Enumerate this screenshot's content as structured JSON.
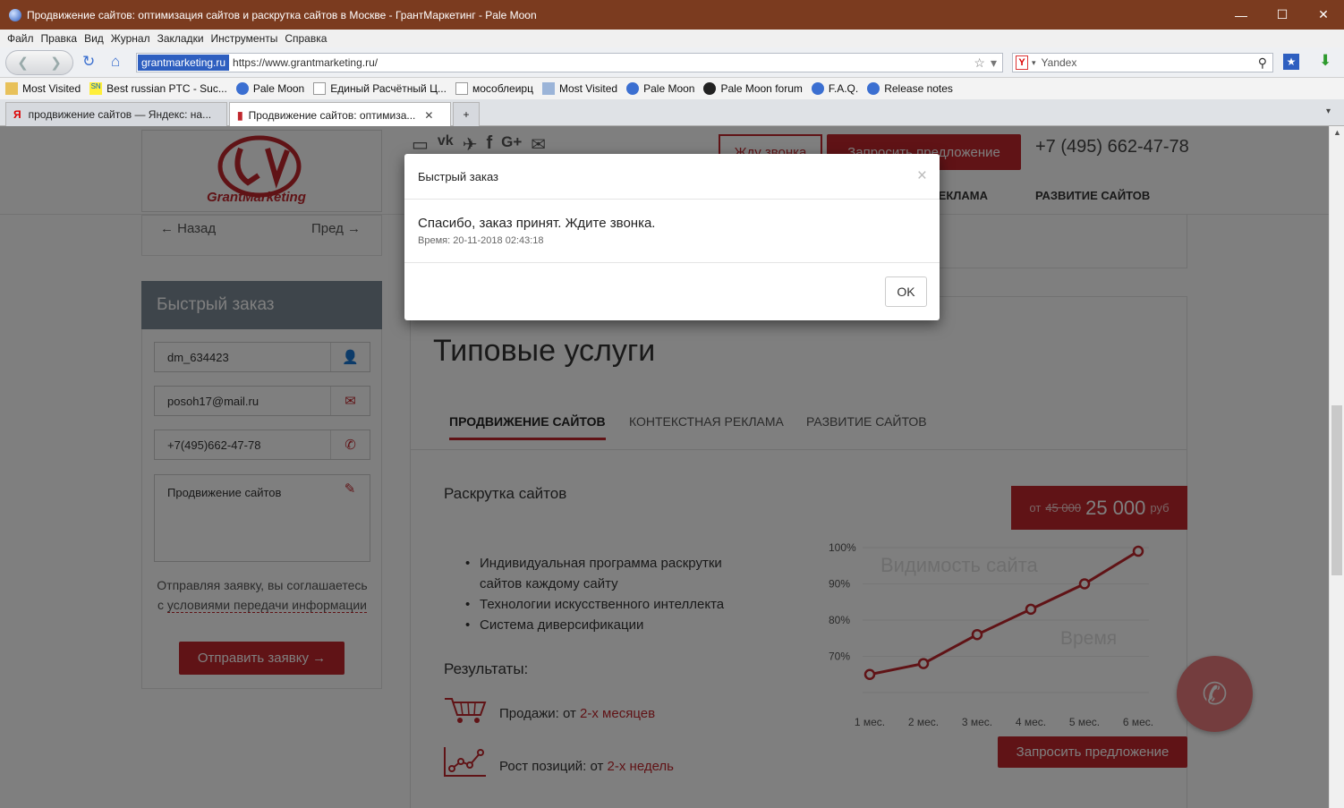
{
  "window": {
    "title": "Продвижение сайтов: оптимизация сайтов и раскрутка сайтов в Москве - ГрантМаркетинг - Pale Moon",
    "minimize": "—",
    "maximize": "☐",
    "close": "✕"
  },
  "menu": [
    "Файл",
    "Правка",
    "Вид",
    "Журнал",
    "Закладки",
    "Инструменты",
    "Справка"
  ],
  "nav": {
    "identity": "grantmarketing.ru",
    "url": "https://www.grantmarketing.ru/",
    "search_engine": "Yandex",
    "search_placeholder": "Yandex"
  },
  "bookmarks": [
    {
      "label": "Most Visited",
      "icon": "folder-icon"
    },
    {
      "label": "Best russian PTC - Suc...",
      "icon": "sn-icon"
    },
    {
      "label": "Pale Moon",
      "icon": "globe-icon"
    },
    {
      "label": "Единый Расчётный Ц...",
      "icon": "page-icon"
    },
    {
      "label": "мособлеирц",
      "icon": "page-icon"
    },
    {
      "label": "Most Visited",
      "icon": "folder-icon"
    },
    {
      "label": "Pale Moon",
      "icon": "globe-icon"
    },
    {
      "label": "Pale Moon forum",
      "icon": "forum-icon"
    },
    {
      "label": "F.A.Q.",
      "icon": "globe-icon"
    },
    {
      "label": "Release notes",
      "icon": "globe-icon"
    }
  ],
  "tabs": [
    {
      "label": "продвижение сайтов — Яндекс: на...",
      "active": false
    },
    {
      "label": "Продвижение сайтов: оптимиза...",
      "active": true
    }
  ],
  "header": {
    "logo_text": "GrantMarketing",
    "callback_label": "Жду звонка",
    "request_label": "Запросить предложение",
    "phone": "+7 (495) 662-47-78",
    "nav_items": [
      "РЕКЛАМА",
      "РАЗВИТИЕ САЙТОВ"
    ]
  },
  "sidebar": {
    "prev_label": "← Назад",
    "next_label": "Пред →",
    "form_title": "Быстрый заказ",
    "name_value": "dm_634423",
    "email_value": "posoh17@mail.ru",
    "phone_value": "+7(495)662-47-78",
    "message_value": "Продвижение сайтов",
    "note_text": "Отправляя заявку, вы соглашаетесь с",
    "note_link": "условиями передачи информации",
    "submit_label": "Отправить заявку →"
  },
  "main": {
    "title": "Типовые услуги",
    "tabs": [
      "ПРОДВИЖЕНИЕ САЙТОВ",
      "КОНТЕКСТНАЯ РЕКЛАМА",
      "РАЗВИТИЕ САЙТОВ"
    ],
    "service_title": "Раскрутка сайтов",
    "price_prefix": "от",
    "price_old": "45 000",
    "price_new": "25 000",
    "price_currency": "руб",
    "bullets": [
      "Индивидуальная программа раскрутки сайтов каждому сайту",
      "Технологии искусственного интеллекта",
      "Система диверсификации"
    ],
    "results_title": "Результаты:",
    "results": [
      {
        "prefix": "Продажи: от",
        "highlight": "2-х месяцев"
      },
      {
        "prefix": "Рост позиций: от",
        "highlight": "2-х недель"
      }
    ],
    "cta_label": "Запросить предложение"
  },
  "chart_data": {
    "type": "line",
    "title": "Видимость сайта",
    "xlabel": "Время",
    "x": [
      "1 мес.",
      "2 мес.",
      "3 мес.",
      "4 мес.",
      "5 мес.",
      "6 мес."
    ],
    "y_ticks": [
      "70%",
      "80%",
      "90%",
      "100%"
    ],
    "ylim": [
      60,
      100
    ],
    "values": [
      65,
      68,
      76,
      83,
      90,
      99
    ],
    "color": "#c0272d"
  },
  "modal": {
    "title": "Быстрый заказ",
    "message": "Спасибо, заказ принят. Ждите звонка.",
    "time": "Время: 20-11-2018 02:43:18",
    "ok_label": "OK",
    "close_label": "×"
  },
  "colors": {
    "accent": "#c0272d",
    "titlebar": "#7b3b1f"
  }
}
